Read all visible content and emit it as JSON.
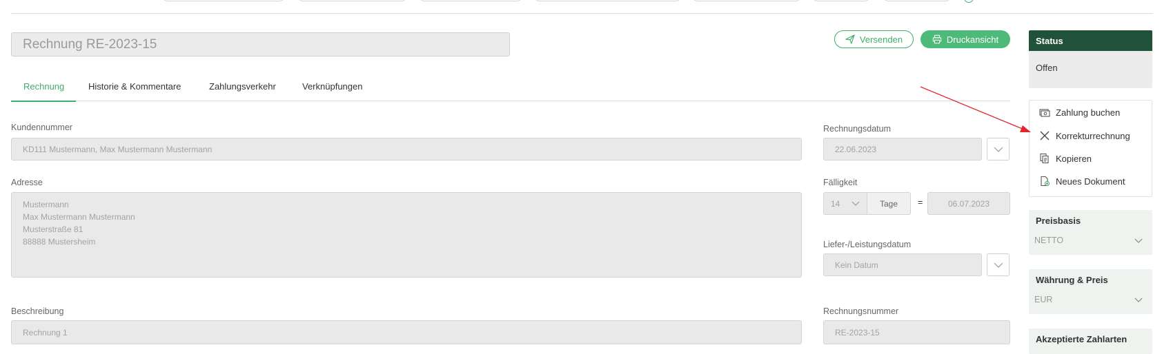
{
  "header": {
    "title_value": "Rechnung RE-2023-15",
    "send_label": "Versenden",
    "print_label": "Druckansicht"
  },
  "tabs": [
    {
      "label": "Rechnung",
      "active": true
    },
    {
      "label": "Historie & Kommentare",
      "active": false
    },
    {
      "label": "Zahlungsverkehr",
      "active": false
    },
    {
      "label": "Verknüpfungen",
      "active": false
    }
  ],
  "form": {
    "customer_label": "Kundennummer",
    "customer_value": "KD111 Mustermann, Max Mustermann Mustermann",
    "address_label": "Adresse",
    "address_lines": [
      "Mustermann",
      "Max Mustermann Mustermann",
      "Musterstraße 81",
      "88888 Mustersheim"
    ],
    "description_label": "Beschreibung",
    "description_value": "Rechnung 1",
    "invoice_date_label": "Rechnungsdatum",
    "invoice_date_value": "22.06.2023",
    "due_label": "Fälligkeit",
    "due_days": "14",
    "due_unit": "Tage",
    "due_equals": "=",
    "due_date": "06.07.2023",
    "delivery_label": "Liefer-/Leistungsdatum",
    "delivery_placeholder": "Kein Datum",
    "invoice_no_label": "Rechnungsnummer",
    "invoice_no_value": "RE-2023-15"
  },
  "sidebar": {
    "status_title": "Status",
    "status_value": "Offen",
    "actions": [
      {
        "label": "Zahlung buchen",
        "icon": "cash-icon"
      },
      {
        "label": "Korrekturrechnung",
        "icon": "close-icon"
      },
      {
        "label": "Kopieren",
        "icon": "copy-icon"
      },
      {
        "label": "Neues Dokument",
        "icon": "new-document-icon"
      }
    ],
    "price_basis_title": "Preisbasis",
    "price_basis_value": "NETTO",
    "currency_title": "Währung & Preis",
    "currency_value": "EUR",
    "payment_title": "Akzeptierte Zahlarten"
  },
  "colors": {
    "accent": "#3fae6a",
    "status_header": "#1f5238",
    "annotation_arrow": "#e0252b"
  }
}
